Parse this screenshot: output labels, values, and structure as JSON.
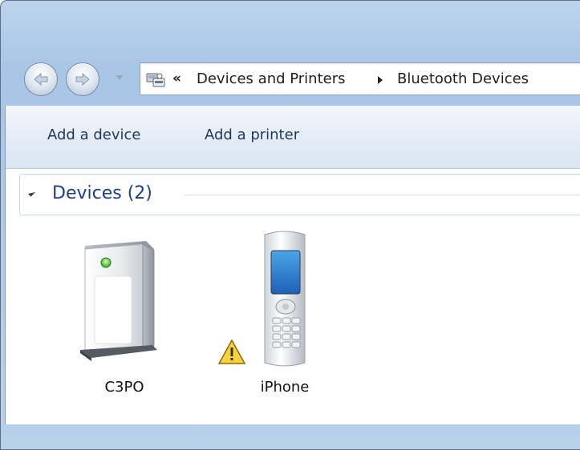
{
  "window": {
    "frame_color": "#b3cbe8",
    "accent": "#1e3f8c"
  },
  "navigation": {
    "back_icon": "back-arrow-icon",
    "forward_icon": "forward-arrow-icon",
    "address_icon": "devices-printers-icon",
    "overflow": "«",
    "breadcrumbs": [
      "Devices and Printers",
      "Bluetooth Devices"
    ]
  },
  "command_bar": {
    "add_device": "Add a device",
    "add_printer": "Add a printer"
  },
  "group": {
    "title": "Devices (2)",
    "items": [
      {
        "label": "C3PO",
        "icon": "computer-tower-icon",
        "warning": false
      },
      {
        "label": "iPhone",
        "icon": "mobile-phone-icon",
        "warning": true
      }
    ]
  }
}
